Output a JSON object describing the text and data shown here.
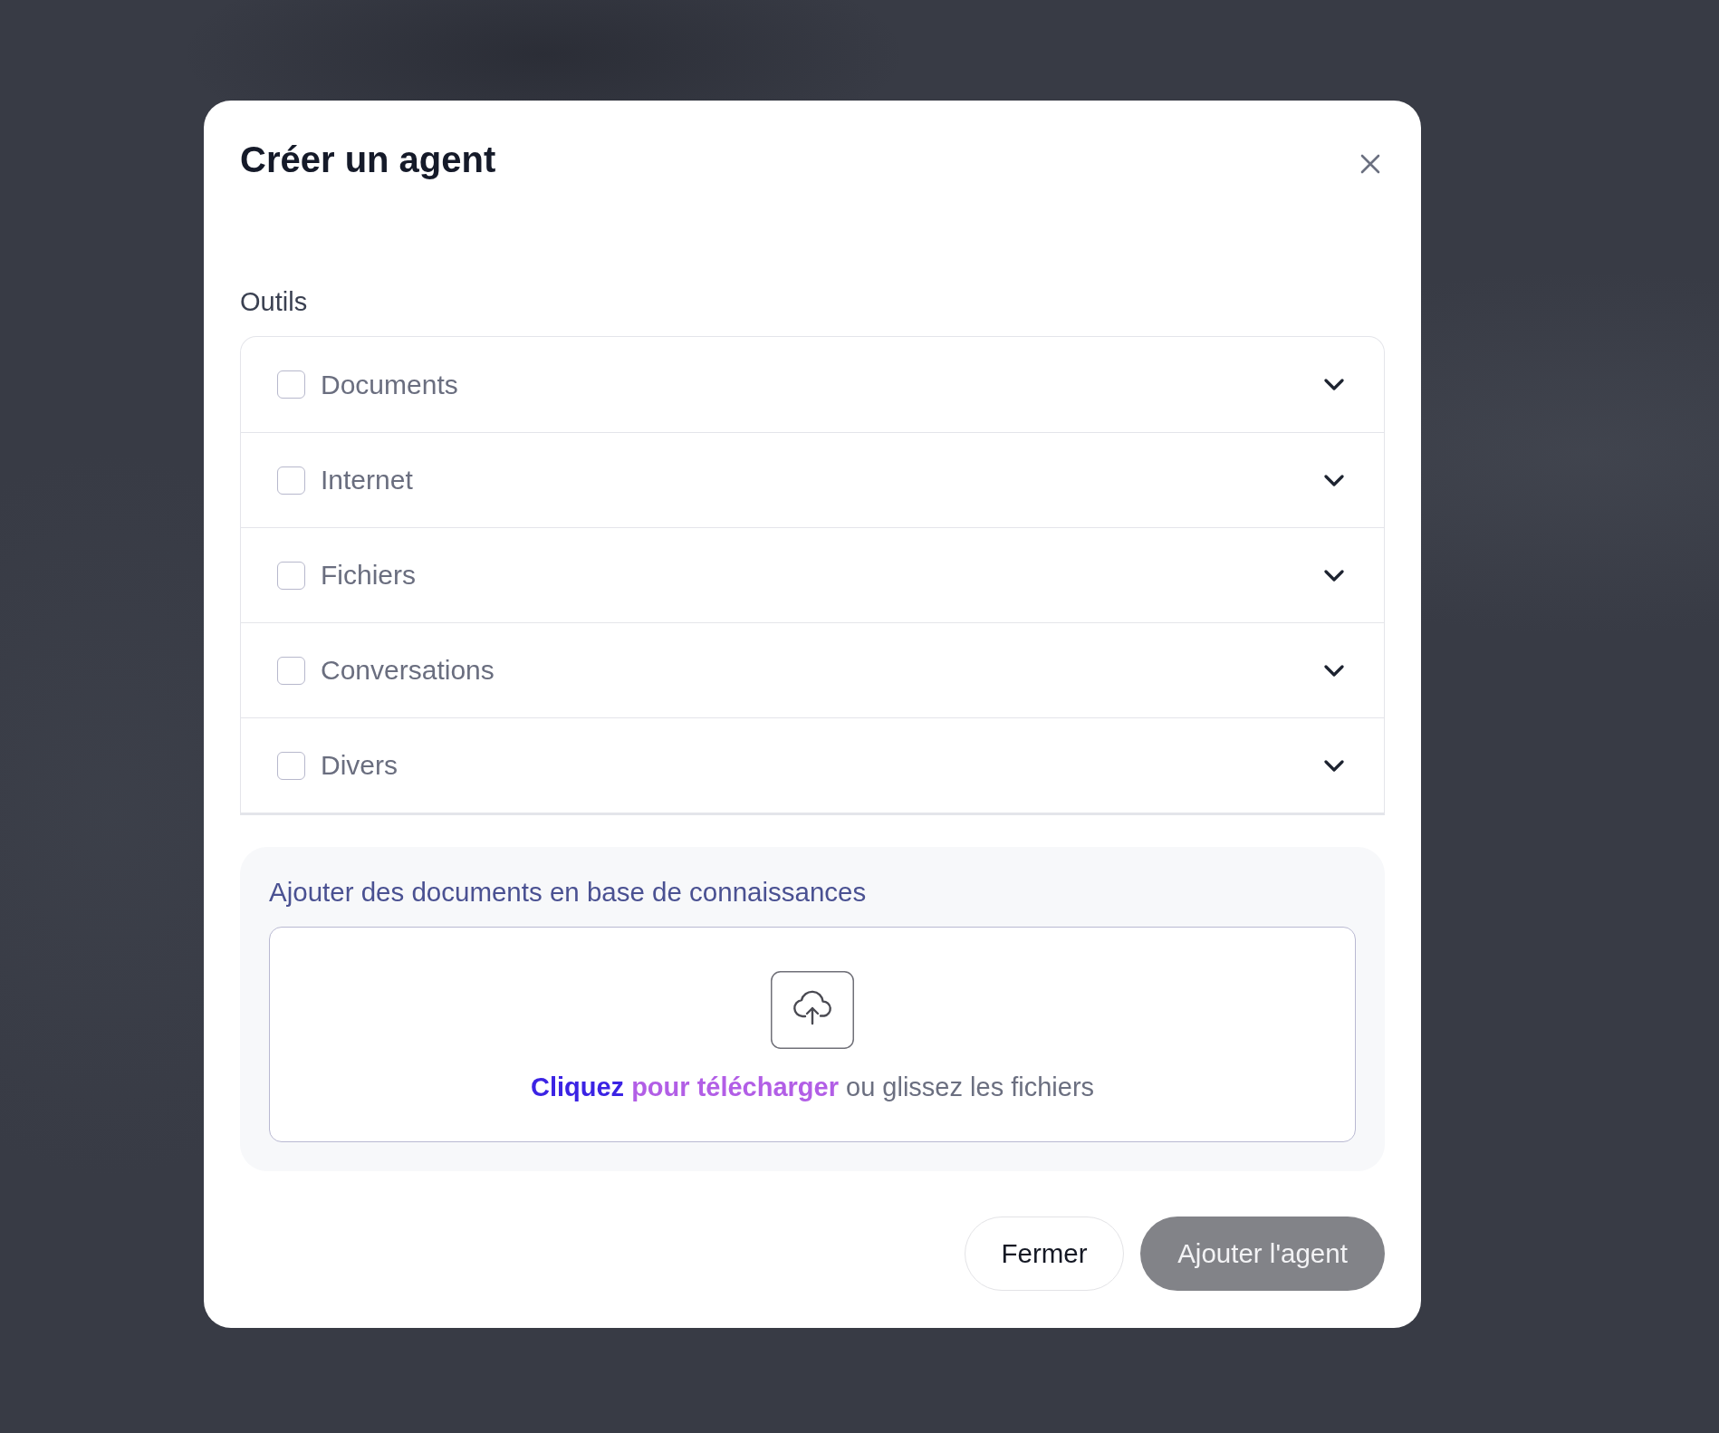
{
  "dialog": {
    "title": "Créer un agent"
  },
  "tools": {
    "label": "Outils",
    "items": [
      {
        "label": "Documents",
        "checked": false,
        "expanded": false
      },
      {
        "label": "Internet",
        "checked": false,
        "expanded": false
      },
      {
        "label": "Fichiers",
        "checked": false,
        "expanded": false
      },
      {
        "label": "Conversations",
        "checked": false,
        "expanded": false
      },
      {
        "label": "Divers",
        "checked": false,
        "expanded": false
      }
    ]
  },
  "upload": {
    "title": "Ajouter des documents en base de connaissances",
    "link_lead": "Cliquez",
    "link_rest": "pour télécharger",
    "hint": "ou glissez les fichiers"
  },
  "buttons": [
    {
      "label": "Fermer",
      "kind": "secondary",
      "disabled": false
    },
    {
      "label": "Ajouter l'agent",
      "kind": "primary",
      "disabled": true
    }
  ]
}
